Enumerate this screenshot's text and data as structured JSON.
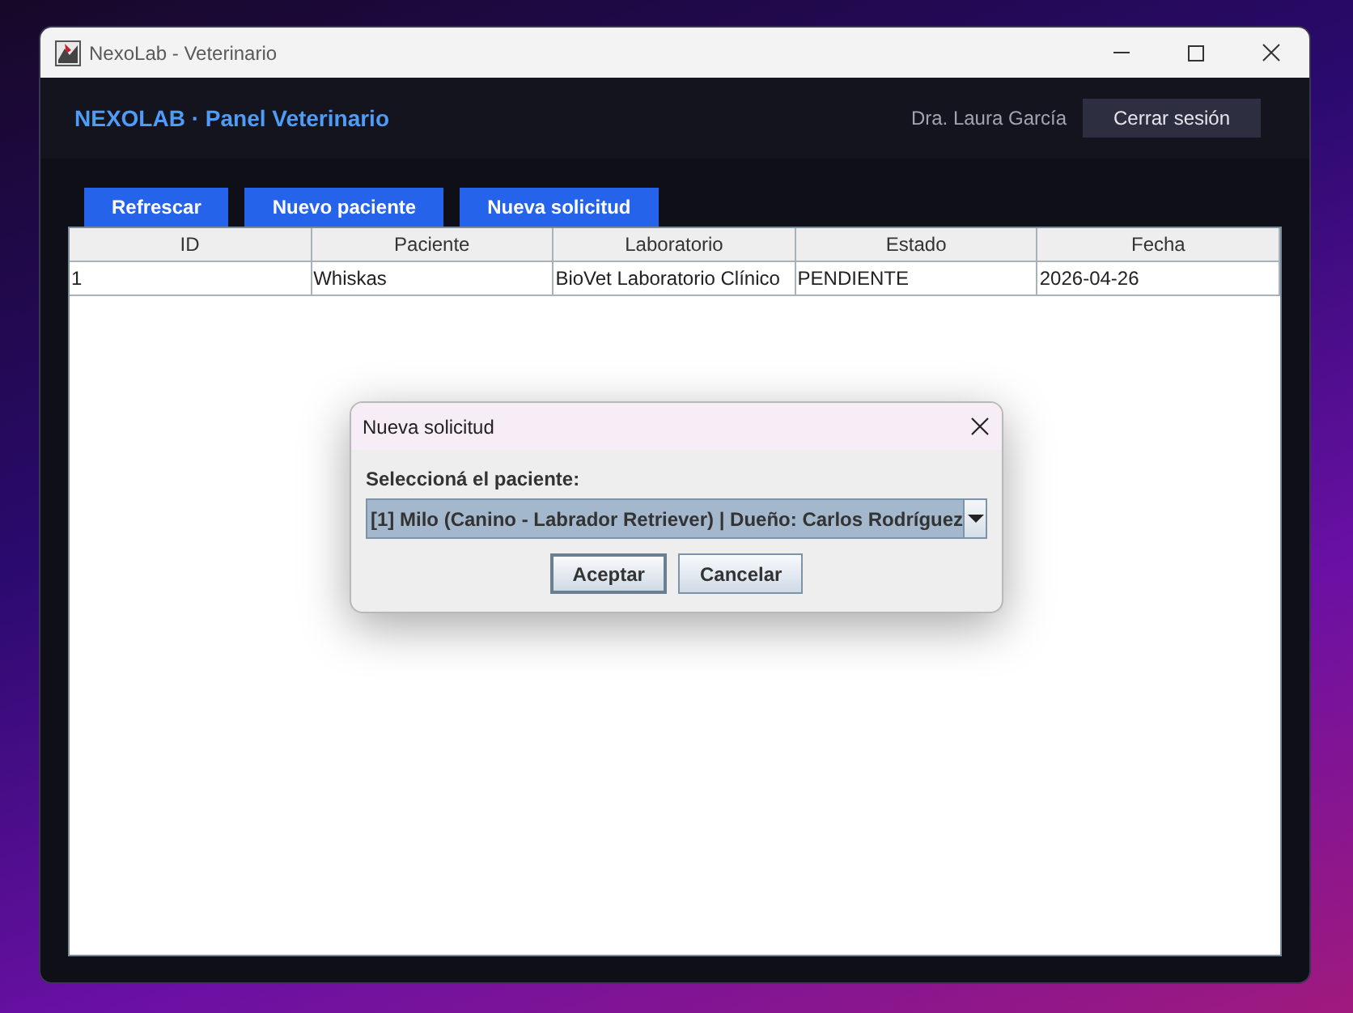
{
  "window": {
    "title": "NexoLab - Veterinario"
  },
  "header": {
    "title": "NEXOLAB · Panel Veterinario",
    "user": "Dra. Laura García",
    "logout_button": "Cerrar sesión"
  },
  "toolbar": {
    "buttons": [
      "Refrescar",
      "Nuevo paciente",
      "Nueva solicitud"
    ]
  },
  "table": {
    "columns": [
      "ID",
      "Paciente",
      "Laboratorio",
      "Estado",
      "Fecha"
    ],
    "rows": [
      [
        "1",
        "Whiskas",
        "BioVet Laboratorio Clínico",
        "PENDIENTE",
        "2026-04-26"
      ]
    ]
  },
  "dialog": {
    "title": "Nueva solicitud",
    "label": "Seleccioná el paciente:",
    "combo": {
      "value": "[1] Milo (Canino - Labrador Retriever) | Dueño: Carlos Rodríguez",
      "focused": true
    },
    "buttons": [
      {
        "label": "Aceptar",
        "default": true
      },
      {
        "label": "Cancelar",
        "default": false
      }
    ]
  }
}
